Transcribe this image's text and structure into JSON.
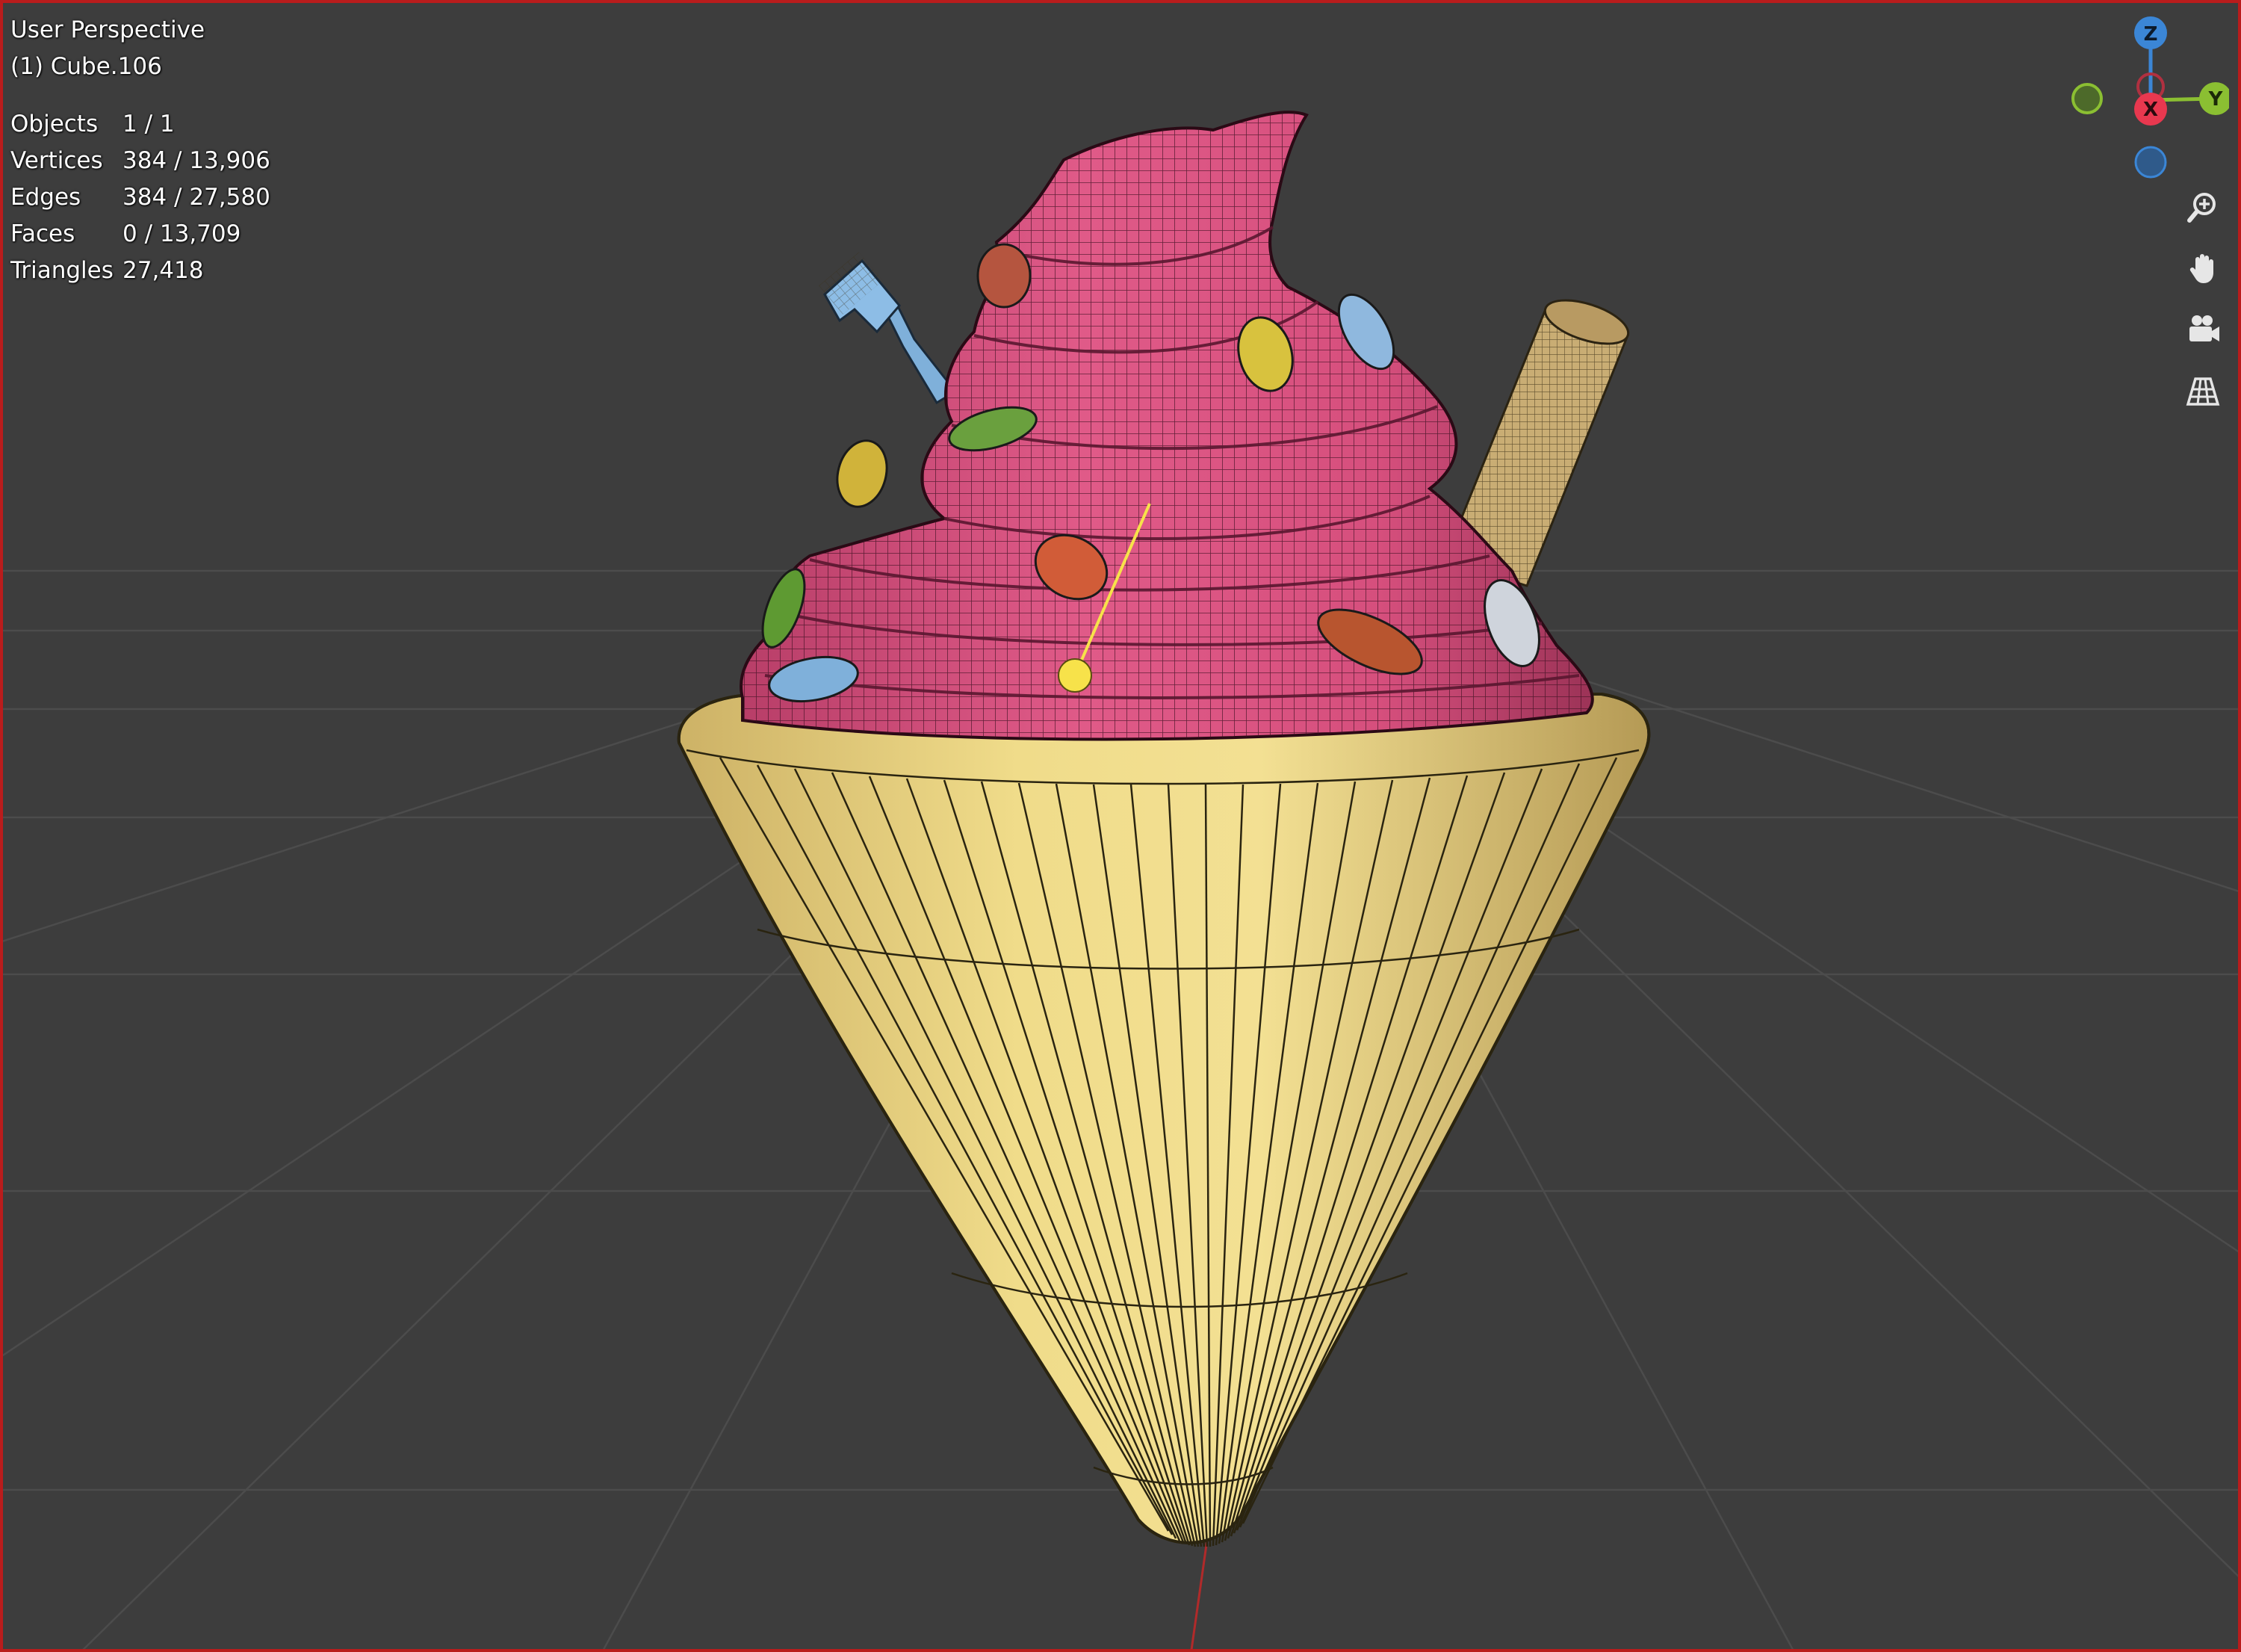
{
  "viewport": {
    "view_name": "User Perspective",
    "object_name": "(1) Cube.106",
    "stats": [
      {
        "label": "Objects",
        "value": "1 / 1"
      },
      {
        "label": "Vertices",
        "value": "384 / 13,906"
      },
      {
        "label": "Edges",
        "value": "384 / 27,580"
      },
      {
        "label": "Faces",
        "value": "0 / 13,709"
      },
      {
        "label": "Triangles",
        "value": "27,418"
      }
    ]
  },
  "gizmo": {
    "z_label": "Z",
    "x_label": "X",
    "y_label": "Y",
    "colors": {
      "x": "#e8384f",
      "y": "#8bbf32",
      "z": "#3b86d6"
    }
  },
  "nav_tools": [
    {
      "icon": "zoom-in-icon"
    },
    {
      "icon": "hand-pan-icon"
    },
    {
      "icon": "camera-view-icon"
    },
    {
      "icon": "orthographic-grid-icon"
    }
  ],
  "scene": {
    "background_color": "#3d3d3d",
    "selection_border_color": "#b91c1c",
    "cone_color": "#f0dc8a",
    "cream_color": "#d9567f",
    "wafer_color": "#c9ad74",
    "spoon_color": "#7fb0da",
    "origin_color": "#f7e24a"
  }
}
